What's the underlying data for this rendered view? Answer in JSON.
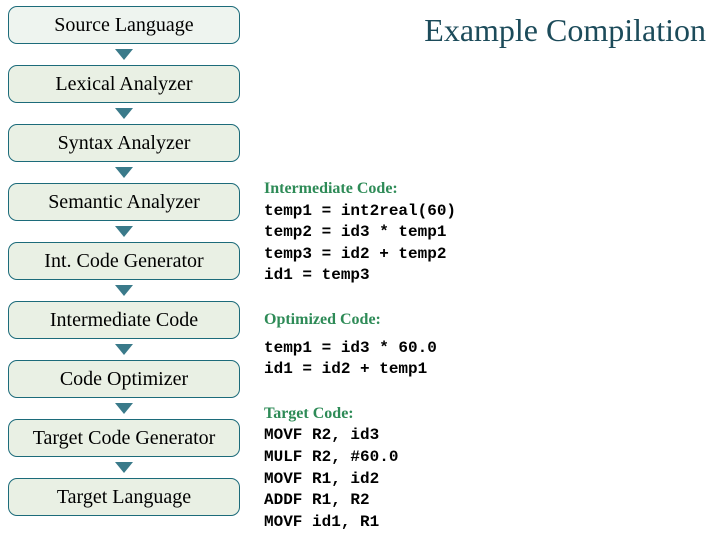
{
  "title": "Example Compilation",
  "pipeline": [
    "Source Language",
    "Lexical Analyzer",
    "Syntax Analyzer",
    "Semantic Analyzer",
    "Int. Code Generator",
    "Intermediate Code",
    "Code Optimizer",
    "Target Code Generator",
    "Target Language"
  ],
  "sections": {
    "intermediate": {
      "heading": "Intermediate Code:",
      "code": "temp1 = int2real(60)\ntemp2 = id3 * temp1\ntemp3 = id2 + temp2\nid1 = temp3"
    },
    "optimized": {
      "heading": "Optimized Code:",
      "code": "temp1 = id3 * 60.0\nid1 = id2 + temp1"
    },
    "target": {
      "heading": "Target Code:",
      "code": "MOVF R2, id3\nMULF R2, #60.0\nMOVF R1, id2\nADDF R1, R2\nMOVF id1, R1"
    }
  }
}
